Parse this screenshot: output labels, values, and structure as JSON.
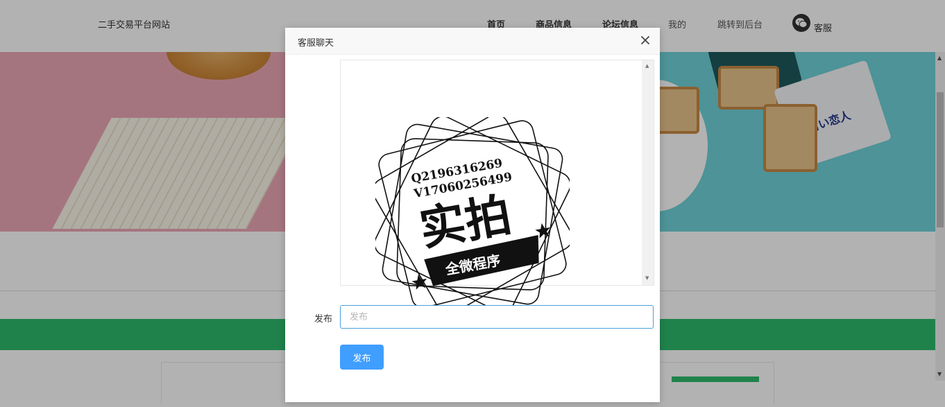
{
  "header": {
    "site_name": "二手交易平台网站",
    "nav": [
      {
        "label": "首页"
      },
      {
        "label": "商品信息"
      },
      {
        "label": "论坛信息"
      },
      {
        "label": "我的"
      },
      {
        "label": "跳转到后台"
      }
    ],
    "service_label": "客服"
  },
  "banner": {
    "package_text": "白い恋人"
  },
  "modal": {
    "title": "客服聊天",
    "stamp_lines": [
      "Q2196316269",
      "V17060256499",
      "实拍",
      "全微程序"
    ],
    "input_label": "发布",
    "input_placeholder": "发布",
    "input_value": "",
    "submit_label": "发布"
  },
  "colors": {
    "accent_green": "#2ebb6c",
    "button_blue": "#409eff",
    "input_border": "#4aa0d8"
  },
  "icons": {
    "close": "close-icon",
    "wechat": "wechat-icon"
  }
}
